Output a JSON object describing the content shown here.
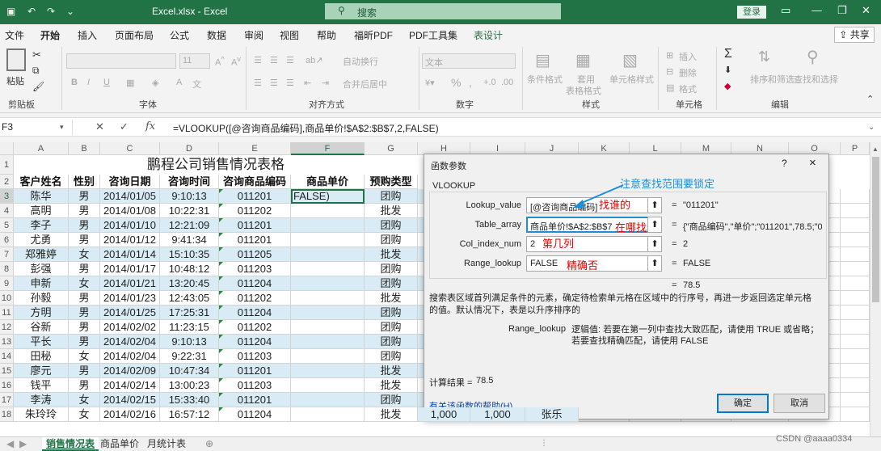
{
  "titlebar": {
    "title": "Excel.xlsx  -  Excel",
    "search": "搜索",
    "login": "登录"
  },
  "menu": [
    "文件",
    "开始",
    "插入",
    "页面布局",
    "公式",
    "数据",
    "审阅",
    "视图",
    "帮助",
    "福昕PDF",
    "PDF工具集",
    "表设计"
  ],
  "share": "共享",
  "ribbon": {
    "paste": "粘贴",
    "clipboard": "剪贴板",
    "font": "字体",
    "align": "对齐方式",
    "number": "数字",
    "styles": "样式",
    "cells": "单元格",
    "edit": "编辑",
    "font_size": "11",
    "wrap": "自动换行",
    "merge": "合并后居中",
    "numfmt": "文本",
    "cond_fmt": "条件格式",
    "table_fmt": "套用",
    "table_fmt2": "表格格式",
    "cell_style": "单元格样式",
    "insert": "插入",
    "delete": "删除",
    "format": "格式",
    "sort": "排序和筛选",
    "find": "查找和选择"
  },
  "formula_bar": {
    "name_box": "F3",
    "formula": "=VLOOKUP([@咨询商品编码],商品单价!$A$2:$B$7,2,FALSE)"
  },
  "columns": [
    "A",
    "B",
    "C",
    "D",
    "E",
    "F",
    "G",
    "H",
    "I",
    "J",
    "K",
    "L",
    "M",
    "N",
    "O",
    "P"
  ],
  "sheet": {
    "title": "鹏程公司销售情况表格",
    "headers": [
      "客户姓名",
      "性别",
      "咨询日期",
      "咨询时间",
      "咨询商品编码",
      "商品单价",
      "预购类型"
    ],
    "rows": [
      [
        "陈华",
        "男",
        "2014/01/05",
        "9:10:13",
        "011201",
        "FALSE)",
        "团购"
      ],
      [
        "高明",
        "男",
        "2014/01/08",
        "10:22:31",
        "011202",
        "",
        "批发"
      ],
      [
        "李子",
        "男",
        "2014/01/10",
        "12:21:09",
        "011201",
        "",
        "团购"
      ],
      [
        "尤勇",
        "男",
        "2014/01/12",
        "9:41:34",
        "011201",
        "",
        "团购"
      ],
      [
        "郑雅婷",
        "女",
        "2014/01/14",
        "15:10:35",
        "011205",
        "",
        "批发"
      ],
      [
        "彭强",
        "男",
        "2014/01/17",
        "10:48:12",
        "011203",
        "",
        "团购"
      ],
      [
        "申新",
        "女",
        "2014/01/21",
        "13:20:45",
        "011204",
        "",
        "团购"
      ],
      [
        "孙毅",
        "男",
        "2014/01/23",
        "12:43:05",
        "011202",
        "",
        "批发"
      ],
      [
        "方明",
        "男",
        "2014/01/25",
        "17:25:31",
        "011204",
        "",
        "团购"
      ],
      [
        "谷新",
        "男",
        "2014/02/02",
        "11:23:15",
        "011202",
        "",
        "团购"
      ],
      [
        "平长",
        "男",
        "2014/02/04",
        "9:10:13",
        "011204",
        "",
        "团购"
      ],
      [
        "田秘",
        "女",
        "2014/02/04",
        "9:22:31",
        "011203",
        "",
        "团购"
      ],
      [
        "廖元",
        "男",
        "2014/02/09",
        "10:47:34",
        "011201",
        "",
        "批发"
      ],
      [
        "钱平",
        "男",
        "2014/02/14",
        "13:00:23",
        "011203",
        "",
        "批发"
      ],
      [
        "李涛",
        "女",
        "2014/02/15",
        "15:33:40",
        "011201",
        "",
        "团购"
      ],
      [
        "朱玲玲",
        "女",
        "2014/02/16",
        "16:57:12",
        "011204",
        "",
        "批发"
      ]
    ],
    "row18_extra": [
      "1,000",
      "1,000",
      "张乐"
    ]
  },
  "tabs": [
    "销售情况表",
    "商品单价",
    "月统计表"
  ],
  "dialog": {
    "title": "函数参数",
    "help": "?",
    "close": "×",
    "func": "VLOOKUP",
    "args": [
      {
        "label": "Lookup_value",
        "value": "[@咨询商品编码]",
        "result": "\"011201\"",
        "note": "找谁的"
      },
      {
        "label": "Table_array",
        "value": "商品单价!$A$2:$B$7",
        "result": "{\"商品编码\",\"单价\";\"011201\",78.5;\"0",
        "note": "在哪找"
      },
      {
        "label": "Col_index_num",
        "value": "2",
        "result": "2",
        "note": "第几列"
      },
      {
        "label": "Range_lookup",
        "value": "FALSE",
        "result": "FALSE",
        "note": "精确否"
      }
    ],
    "eq": "=",
    "total": "78.5",
    "desc": "搜索表区域首列满足条件的元素，确定待检索单元格在区域中的行序号，再进一步返回选定单元格的值。默认情况下，表是以升序排序的",
    "param_name": "Range_lookup",
    "param_desc": "逻辑值: 若要在第一列中查找大致匹配，请使用 TRUE 或省略；若要查找精确匹配，请使用 FALSE",
    "calc_label": "计算结果 =",
    "calc_value": "78.5",
    "help_link": "有关该函数的帮助(H)",
    "ok": "确定",
    "cancel": "取消",
    "annotation": "注意查找范围要锁定"
  },
  "watermark": "CSDN @aaaa0334"
}
